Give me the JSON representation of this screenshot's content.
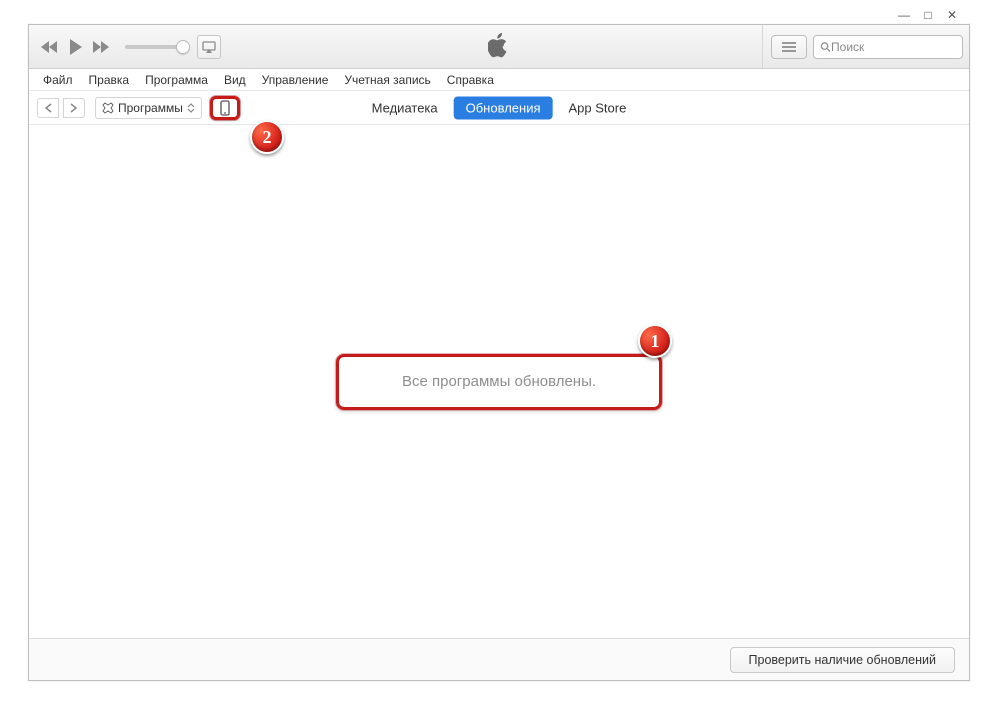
{
  "window": {
    "minimize": "—",
    "maximize": "□",
    "close": "✕"
  },
  "menubar": [
    "Файл",
    "Правка",
    "Программа",
    "Вид",
    "Управление",
    "Учетная запись",
    "Справка"
  ],
  "toolbar": {
    "search_placeholder": "Поиск"
  },
  "nav": {
    "category_label": "Программы",
    "tabs": {
      "library": "Медиатека",
      "updates": "Обновления",
      "store": "App Store"
    },
    "active_tab": "updates"
  },
  "content": {
    "status_text": "Все программы обновлены."
  },
  "footer": {
    "check_updates_label": "Проверить наличие обновлений"
  },
  "annotations": {
    "step1": "1",
    "step2": "2"
  }
}
